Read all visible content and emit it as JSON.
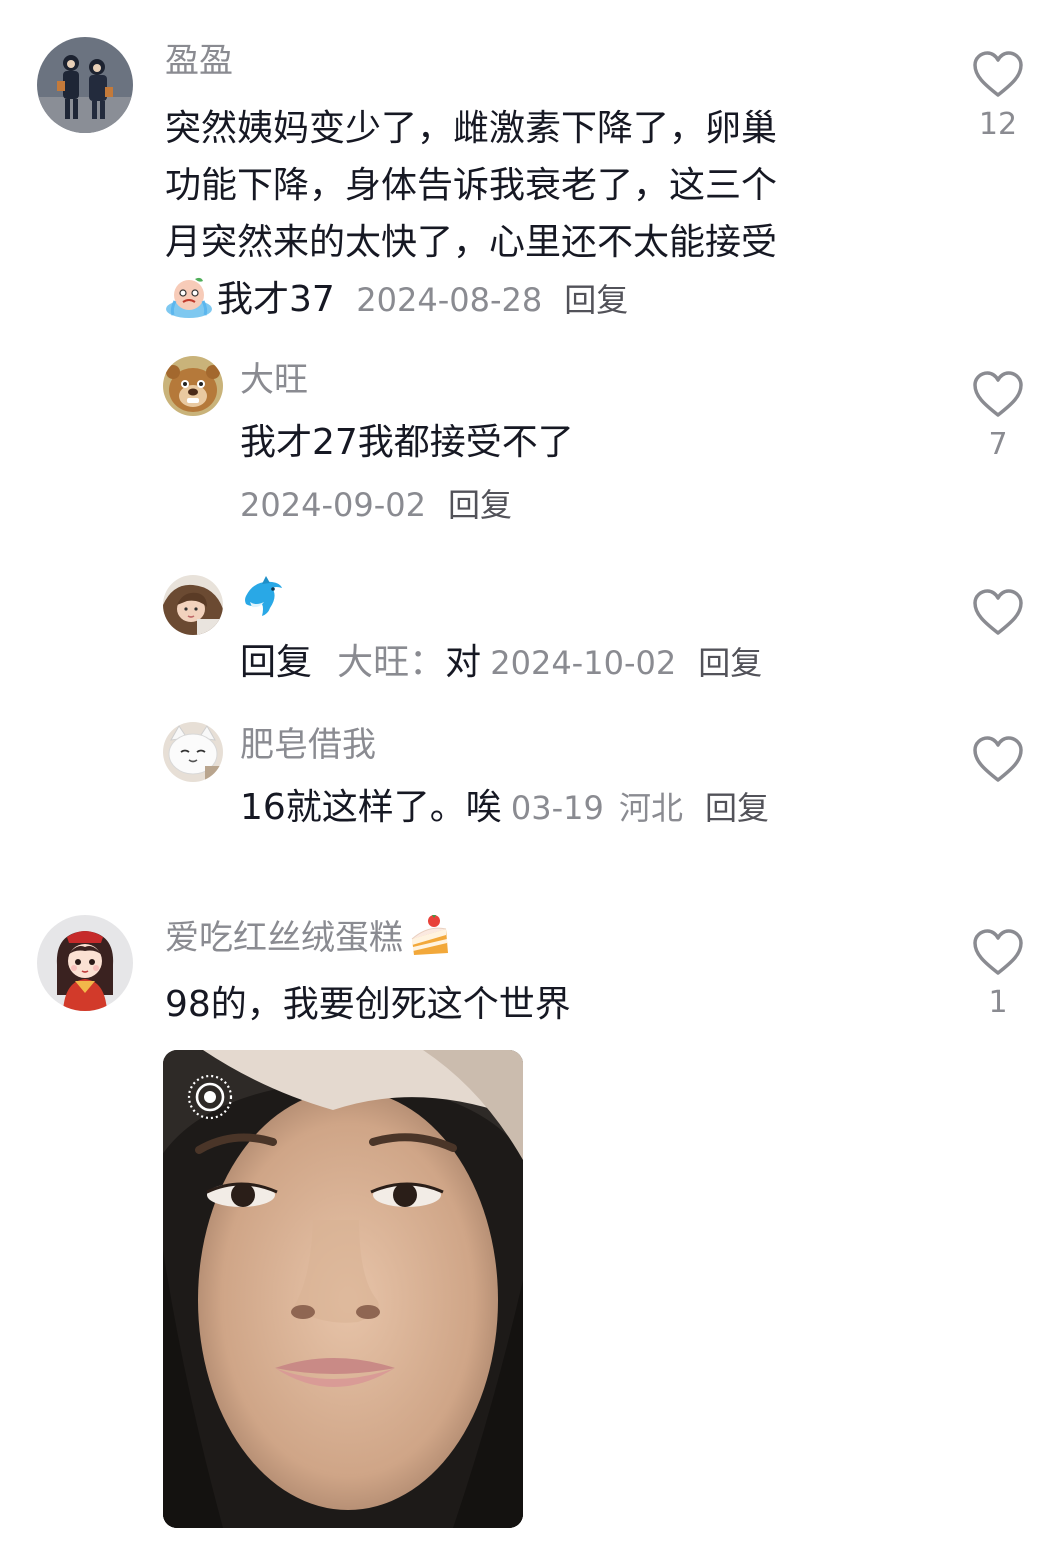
{
  "comments": [
    {
      "user": "盈盈",
      "text": "突然姨妈变少了，雌激素下降了，卵巢功能下降，身体告诉我衰老了，这三个月突然来的太快了，心里还不太能接受",
      "text_lines": [
        "突然姨妈变少了，雌激素下降了，卵巢",
        "功能下降，身体告诉我衰老了，这三个",
        "月突然来的太快了，心里还不太能接受"
      ],
      "text_tail": "我才37",
      "date": "2024-08-28",
      "reply_label": "回复",
      "likes": "12",
      "avatar_icon": "couple-avatar-icon"
    },
    {
      "user": "大旺",
      "text": "我才27我都接受不了",
      "date": "2024-09-02",
      "reply_label": "回复",
      "likes": "7",
      "avatar_icon": "cartoon-bear-avatar-icon"
    },
    {
      "user": "🐬",
      "reply_prefix": "回复",
      "reply_to": "大旺：",
      "text": "对",
      "date": "2024-10-02",
      "reply_label": "回复",
      "avatar_icon": "girl-avatar-icon"
    },
    {
      "user": "肥皂借我",
      "text": "16就这样了。唉",
      "date": "03-19",
      "location": "河北",
      "reply_label": "回复",
      "avatar_icon": "white-cat-avatar-icon"
    },
    {
      "user": "爱吃红丝绒蛋糕",
      "user_emoji": "cake-icon",
      "text": "98的，我要创死这个世界",
      "likes": "1",
      "avatar_icon": "cartoon-girl-avatar-icon",
      "photo": "selfie-photo",
      "photo_badge": "live-photo-icon"
    }
  ],
  "colors": {
    "primary_text": "#161823",
    "secondary_text": "#8a8b91",
    "reply_link": "#525259",
    "heart_outline": "#8a8b91",
    "background": "#ffffff"
  }
}
